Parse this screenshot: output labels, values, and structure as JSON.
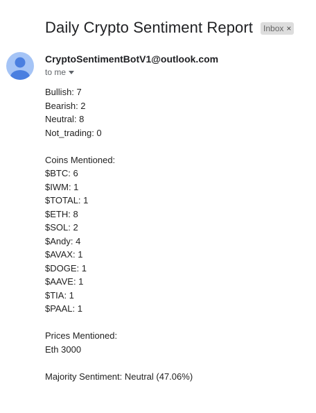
{
  "email": {
    "subject": "Daily Crypto Sentiment Report",
    "label": "Inbox",
    "label_remove": "×",
    "sender": "CryptoSentimentBotV1@outlook.com",
    "recipient": "to me",
    "avatar_icon": "person-icon"
  },
  "body": {
    "sentiment_counts": [
      "Bullish: 7",
      "Bearish: 2",
      "Neutral: 8",
      "Not_trading: 0"
    ],
    "coins_heading": "Coins Mentioned:",
    "coins": [
      "$BTC: 6",
      "$IWM: 1",
      "$TOTAL: 1",
      "$ETH: 8",
      "$SOL: 2",
      "$Andy: 4",
      "$AVAX: 1",
      "$DOGE: 1",
      "$AAVE: 1",
      "$TIA: 1",
      "$PAAL: 1"
    ],
    "prices_heading": "Prices Mentioned:",
    "prices": [
      "Eth 3000"
    ],
    "majority": "Majority Sentiment: Neutral (47.06%)"
  },
  "colors": {
    "avatar_bg": "#a5c4f6",
    "avatar_fg": "#4a7fe0",
    "label_bg": "#dddddd"
  }
}
